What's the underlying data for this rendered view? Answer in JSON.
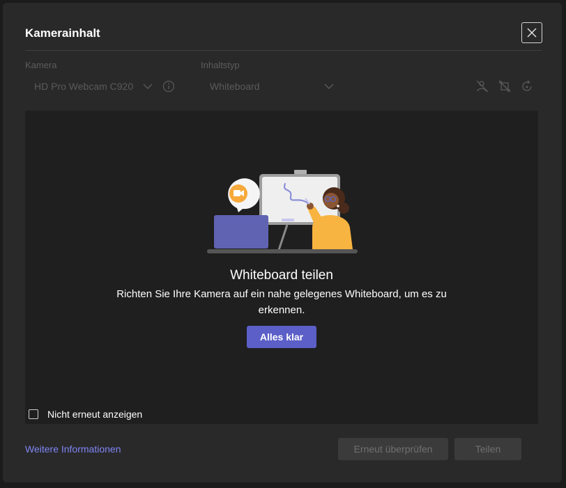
{
  "dialog": {
    "title": "Kamerainhalt"
  },
  "camera": {
    "label": "Kamera",
    "value": "HD Pro Webcam C920"
  },
  "content_type": {
    "label": "Inhaltstyp",
    "value": "Whiteboard"
  },
  "preview": {
    "headline": "Whiteboard teilen",
    "description": "Richten Sie Ihre Kamera auf ein nahe gelegenes Whiteboard, um es zu erkennen.",
    "ok_label": "Alles klar",
    "checkbox_label": "Nicht erneut anzeigen"
  },
  "footer": {
    "link_label": "Weitere Informationen",
    "recheck_label": "Erneut überprüfen",
    "share_label": "Teilen"
  },
  "colors": {
    "accent": "#5b5fc7",
    "link": "#7f85f5",
    "background": "#292929"
  },
  "icons": {
    "close": "close-icon",
    "chevron": "chevron-down-icon",
    "info": "info-icon"
  }
}
